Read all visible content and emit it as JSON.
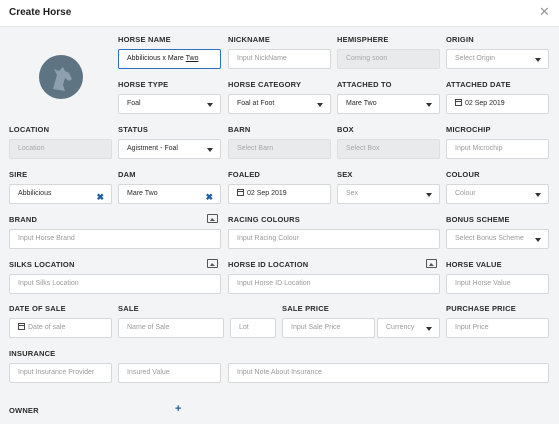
{
  "title": "Create Horse",
  "labels": {
    "horse_name": "HORSE NAME",
    "nickname": "NICKNAME",
    "hemisphere": "HEMISPHERE",
    "origin": "ORIGIN",
    "horse_type": "HORSE TYPE",
    "horse_category": "HORSE CATEGORY",
    "attached_to": "ATTACHED TO",
    "attached_date": "ATTACHED DATE",
    "location": "LOCATION",
    "status": "STATUS",
    "barn": "BARN",
    "box": "BOX",
    "microchip": "MICROCHIP",
    "sire": "SIRE",
    "dam": "DAM",
    "foaled": "FOALED",
    "sex": "SEX",
    "colour": "COLOUR",
    "brand": "BRAND",
    "racing_colours": "RACING COLOURS",
    "bonus_scheme": "BONUS SCHEME",
    "silks_location": "SILKS LOCATION",
    "horse_id_location": "HORSE ID LOCATION",
    "horse_value": "HORSE VALUE",
    "date_of_sale": "DATE OF SALE",
    "sale": "SALE",
    "sale_price": "SALE PRICE",
    "purchase_price": "PURCHASE PRICE",
    "insurance": "INSURANCE",
    "owner": "OWNER"
  },
  "fields": {
    "horse_name_value": "Abbilicious x Mare Two",
    "horse_name_prefix": "Abbilicious x Mare ",
    "horse_name_suffix": "Two",
    "nickname_ph": "Input NickName",
    "hemisphere_value": "Coming soon",
    "origin_value": "Select Origin",
    "horse_type_value": "Foal",
    "horse_category_value": "Foal at Foot",
    "attached_to_value": "Mare Two",
    "attached_date_value": "02 Sep 2019",
    "location_ph": "Location",
    "status_value": "Agistment - Foal",
    "barn_ph": "Select Barn",
    "box_ph": "Select Box",
    "microchip_ph": "Input Microchip",
    "sire_value": "Abbilicious",
    "dam_value": "Mare Two",
    "foaled_value": "02 Sep 2019",
    "sex_value": "Sex",
    "colour_value": "Colour",
    "brand_ph": "Input Horse Brand",
    "racing_colour_ph": "Input Racing Colour",
    "bonus_scheme_value": "Select Bonus Scheme",
    "silks_location_ph": "Input Silks Location",
    "horse_id_location_ph": "Input Horse ID Location",
    "horse_value_ph": "Input Horse Value",
    "date_of_sale_ph": "Date of sale",
    "sale_name_ph": "Name of Sale",
    "lot_ph": "Lot",
    "sale_price_ph": "Input Sale Price",
    "currency_value": "Currency",
    "purchase_price_ph": "Input Price",
    "insurance_provider_ph": "Input Insurance Provider",
    "insured_value_ph": "Insured Value",
    "insurance_note_ph": "Input Note About Insurance"
  },
  "icons": {
    "close": "close-icon",
    "avatar": "horse-avatar-icon",
    "calendar": "calendar-icon",
    "clear": "clear-x-icon",
    "image": "image-icon",
    "add": "plus-icon"
  },
  "colors": {
    "accent": "#1f5fa8",
    "background": "#f3f4f5",
    "avatar": "#5f7483"
  }
}
